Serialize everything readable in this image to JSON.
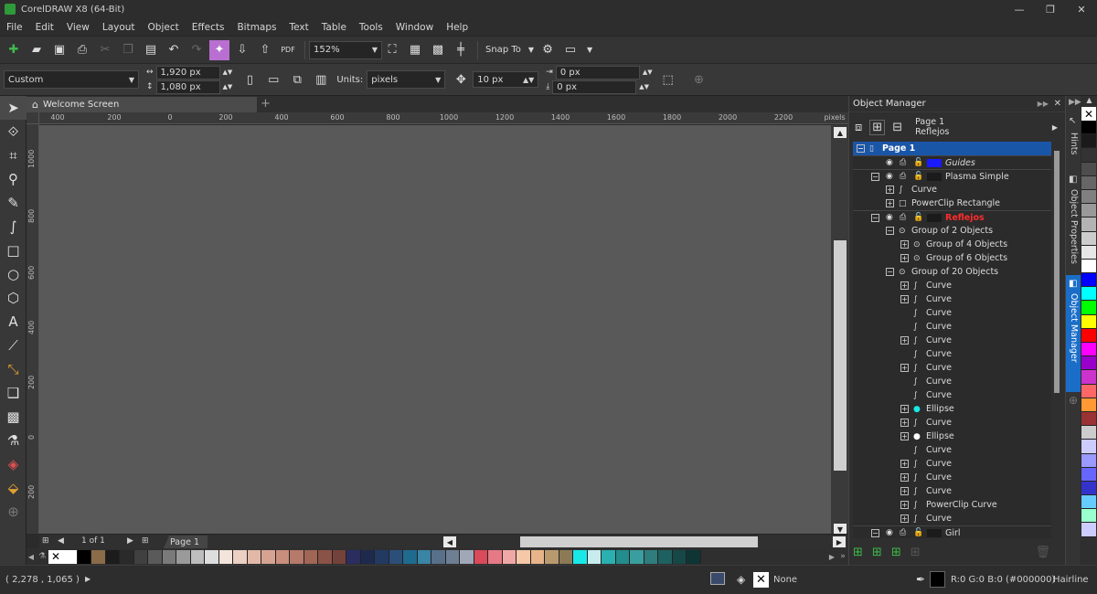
{
  "window": {
    "title": "CorelDRAW X8 (64-Bit)",
    "minimize": "—",
    "maximize": "❐",
    "close": "✕"
  },
  "menu": [
    "File",
    "Edit",
    "View",
    "Layout",
    "Object",
    "Effects",
    "Bitmaps",
    "Text",
    "Table",
    "Tools",
    "Window",
    "Help"
  ],
  "toolbar": {
    "zoom": "152%",
    "snap": "Snap To"
  },
  "propbar": {
    "preset": "Custom",
    "width": "1,920 px",
    "height": "1,080 px",
    "units_label": "Units:",
    "units": "pixels",
    "nudge": "10 px",
    "dup_x": "0 px",
    "dup_y": "0 px"
  },
  "tabs": {
    "doc": "Welcome Screen",
    "add": "+"
  },
  "ruler": {
    "h": [
      "400",
      "200",
      "0",
      "200",
      "400",
      "600",
      "800",
      "1000",
      "1200",
      "1400",
      "1600",
      "1800",
      "2000",
      "2200"
    ],
    "unit": "pixels",
    "v": [
      "1000",
      "800",
      "600",
      "400",
      "200",
      "0",
      "200"
    ]
  },
  "pagebar": {
    "page_of": "1  of  1",
    "page_tab": "Page 1"
  },
  "status": {
    "coords": "( 2,278 , 1,065 )",
    "fill": "None",
    "outline_color": "R:0 G:0 B:0 (#000000)",
    "outline": "Hairline"
  },
  "om": {
    "title": "Object Manager",
    "page_name": "Page 1",
    "layer_name": "Reflejos",
    "tree": [
      {
        "label": "Page 1",
        "level": 0,
        "exp": "−",
        "icon": "page",
        "selected": true
      },
      {
        "label": "Guides",
        "level": 1,
        "exp": "",
        "layer": true,
        "color": "#1a1aff",
        "italic": true
      },
      {
        "label": "Plasma Simple",
        "level": 1,
        "exp": "−",
        "layer": true,
        "color": "#1b1b1b"
      },
      {
        "label": "Curve",
        "level": 2,
        "exp": "+",
        "icon": "curve"
      },
      {
        "label": "PowerClip Rectangle",
        "level": 2,
        "exp": "+",
        "icon": "rect"
      },
      {
        "label": "Reflejos",
        "level": 1,
        "exp": "−",
        "layer": true,
        "color": "#1b1b1b",
        "red": true
      },
      {
        "label": "Group of 2 Objects",
        "level": 2,
        "exp": "−",
        "icon": "group"
      },
      {
        "label": "Group of 4 Objects",
        "level": 3,
        "exp": "+",
        "icon": "group"
      },
      {
        "label": "Group of 6 Objects",
        "level": 3,
        "exp": "+",
        "icon": "group"
      },
      {
        "label": "Group of 20 Objects",
        "level": 2,
        "exp": "−",
        "icon": "group"
      },
      {
        "label": "Curve",
        "level": 3,
        "exp": "+",
        "icon": "curve"
      },
      {
        "label": "Curve",
        "level": 3,
        "exp": "+",
        "icon": "curve"
      },
      {
        "label": "Curve",
        "level": 3,
        "exp": "",
        "icon": "curve"
      },
      {
        "label": "Curve",
        "level": 3,
        "exp": "",
        "icon": "curve"
      },
      {
        "label": "Curve",
        "level": 3,
        "exp": "+",
        "icon": "curve"
      },
      {
        "label": "Curve",
        "level": 3,
        "exp": "",
        "icon": "curve"
      },
      {
        "label": "Curve",
        "level": 3,
        "exp": "+",
        "icon": "curve"
      },
      {
        "label": "Curve",
        "level": 3,
        "exp": "",
        "icon": "curve"
      },
      {
        "label": "Curve",
        "level": 3,
        "exp": "",
        "icon": "curve"
      },
      {
        "label": "Ellipse",
        "level": 3,
        "exp": "+",
        "icon": "ellipse-cyan"
      },
      {
        "label": "Curve",
        "level": 3,
        "exp": "+",
        "icon": "curve"
      },
      {
        "label": "Ellipse",
        "level": 3,
        "exp": "+",
        "icon": "ellipse-white"
      },
      {
        "label": "Curve",
        "level": 3,
        "exp": "",
        "icon": "curve"
      },
      {
        "label": "Curve",
        "level": 3,
        "exp": "+",
        "icon": "curve"
      },
      {
        "label": "Curve",
        "level": 3,
        "exp": "+",
        "icon": "curve"
      },
      {
        "label": "Curve",
        "level": 3,
        "exp": "+",
        "icon": "curve"
      },
      {
        "label": "PowerClip Curve",
        "level": 3,
        "exp": "+",
        "icon": "curve"
      },
      {
        "label": "Curve",
        "level": 3,
        "exp": "+",
        "icon": "curve"
      },
      {
        "label": "Girl",
        "level": 1,
        "exp": "−",
        "layer": true,
        "color": "#1b1b1b"
      }
    ]
  },
  "docker_tabs": {
    "hints": "Hints",
    "props": "Object Properties",
    "om": "Object Manager"
  },
  "palette": [
    "#ffffff",
    "#000000",
    "#8a6b4a",
    "#1c1c1c",
    "#2a2a2a",
    "#404040",
    "#5a5a5a",
    "#7a7a7a",
    "#9a9a9a",
    "#bdbdbd",
    "#dedede",
    "#f3e4dc",
    "#ecd0c4",
    "#e2b9a8",
    "#d6a392",
    "#c98e7d",
    "#b67a6a",
    "#a06656",
    "#8a5348",
    "#73423a",
    "#2b2d5e",
    "#1d2a4e",
    "#223a62",
    "#2c4f79",
    "#1f6b8f",
    "#3a84a6",
    "#58708a",
    "#6e7e93",
    "#a0a8b8",
    "#d94a5a",
    "#e57a86",
    "#f0a8a6",
    "#f4c8a8",
    "#e8b48a",
    "#b99a6e",
    "#8c7a56",
    "#19e8e8",
    "#c8ecee",
    "#2ab0b0",
    "#238c8c",
    "#3a9e9e",
    "#2f7d7d",
    "#1f6060",
    "#164848",
    "#0f3434"
  ],
  "colorcol": [
    "#000000",
    "#1a1a1a",
    "#333333",
    "#4d4d4d",
    "#666666",
    "#808080",
    "#999999",
    "#b3b3b3",
    "#cccccc",
    "#e6e6e6",
    "#ffffff",
    "#0000ff",
    "#00ffff",
    "#00ff00",
    "#ffff00",
    "#ff0000",
    "#ff00ff",
    "#9900cc",
    "#cc33cc",
    "#ff6666",
    "#ff9933",
    "#993333",
    "#cccccc",
    "#ccccff",
    "#9999ff",
    "#6666ff",
    "#3333cc",
    "#66ccff",
    "#99ffcc",
    "#ccccff"
  ]
}
